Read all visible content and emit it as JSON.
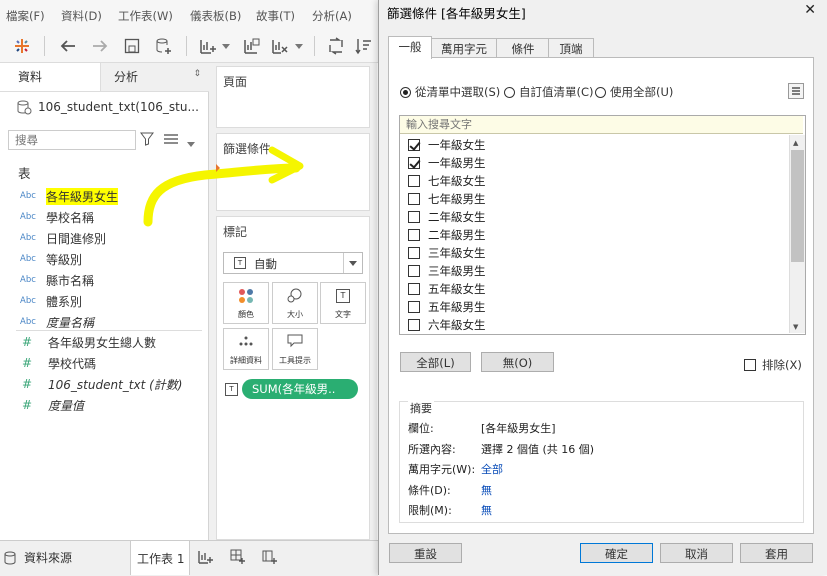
{
  "menu": [
    "檔案(F)",
    "資料(D)",
    "工作表(W)",
    "儀表板(B)",
    "故事(T)",
    "分析(A)"
  ],
  "data_pane": {
    "tabs": {
      "data": "資料",
      "analysis": "分析"
    },
    "datasource": "106_student_txt(106_stu...",
    "search_placeholder": "搜尋",
    "section_table": "表",
    "dimensions": [
      "各年級男女生",
      "學校名稱",
      "日間進修別",
      "等級別",
      "縣市名稱",
      "體系別",
      "度量名稱"
    ],
    "measures": [
      "各年級男女生總人數",
      "學校代碼",
      "106_student_txt (計數)",
      "度量值"
    ],
    "abc_label": "Abc",
    "hash_label": "#"
  },
  "shelves": {
    "pages": "頁面",
    "filters": "篩選條件",
    "marks": "標記",
    "mark_type": "自動",
    "mark_buttons": [
      "顏色",
      "大小",
      "文字",
      "詳細資料",
      "工具提示"
    ],
    "pill": "SUM(各年級男..",
    "pill_icon": "T"
  },
  "bottom": {
    "datasource_tab": "資料來源",
    "sheet_tab": "工作表 1"
  },
  "dialog": {
    "title": "篩選條件 [各年級男女生]",
    "close": "✕",
    "tabs": [
      "一般",
      "萬用字元",
      "條件",
      "頂端"
    ],
    "radios": [
      "從清單中選取(S)",
      "自訂值清單(C)",
      "使用全部(U)"
    ],
    "search_placeholder": "輸入搜尋文字",
    "items": [
      {
        "label": "一年級女生",
        "checked": true
      },
      {
        "label": "一年級男生",
        "checked": true
      },
      {
        "label": "七年級女生",
        "checked": false
      },
      {
        "label": "七年級男生",
        "checked": false
      },
      {
        "label": "二年級女生",
        "checked": false
      },
      {
        "label": "二年級男生",
        "checked": false
      },
      {
        "label": "三年級女生",
        "checked": false
      },
      {
        "label": "三年級男生",
        "checked": false
      },
      {
        "label": "五年級女生",
        "checked": false
      },
      {
        "label": "五年級男生",
        "checked": false
      },
      {
        "label": "六年級女生",
        "checked": false
      }
    ],
    "all_button": "全部(L)",
    "none_button": "無(O)",
    "exclude": "排除(X)",
    "summary": {
      "title": "摘要",
      "rows": [
        {
          "key": "欄位:",
          "value": "[各年級男女生]",
          "link": false
        },
        {
          "key": "所選內容:",
          "value": "選擇 2 個值 (共 16 個)",
          "link": false
        },
        {
          "key": "萬用字元(W):",
          "value": "全部",
          "link": true
        },
        {
          "key": "條件(D):",
          "value": "無",
          "link": true
        },
        {
          "key": "限制(M):",
          "value": "無",
          "link": true
        }
      ]
    },
    "reset": "重設",
    "ok": "確定",
    "cancel": "取消",
    "apply": "套用"
  },
  "colors": {
    "highlight": "#ffff00",
    "pill": "#2aae72",
    "accent": "#0a4db8"
  }
}
